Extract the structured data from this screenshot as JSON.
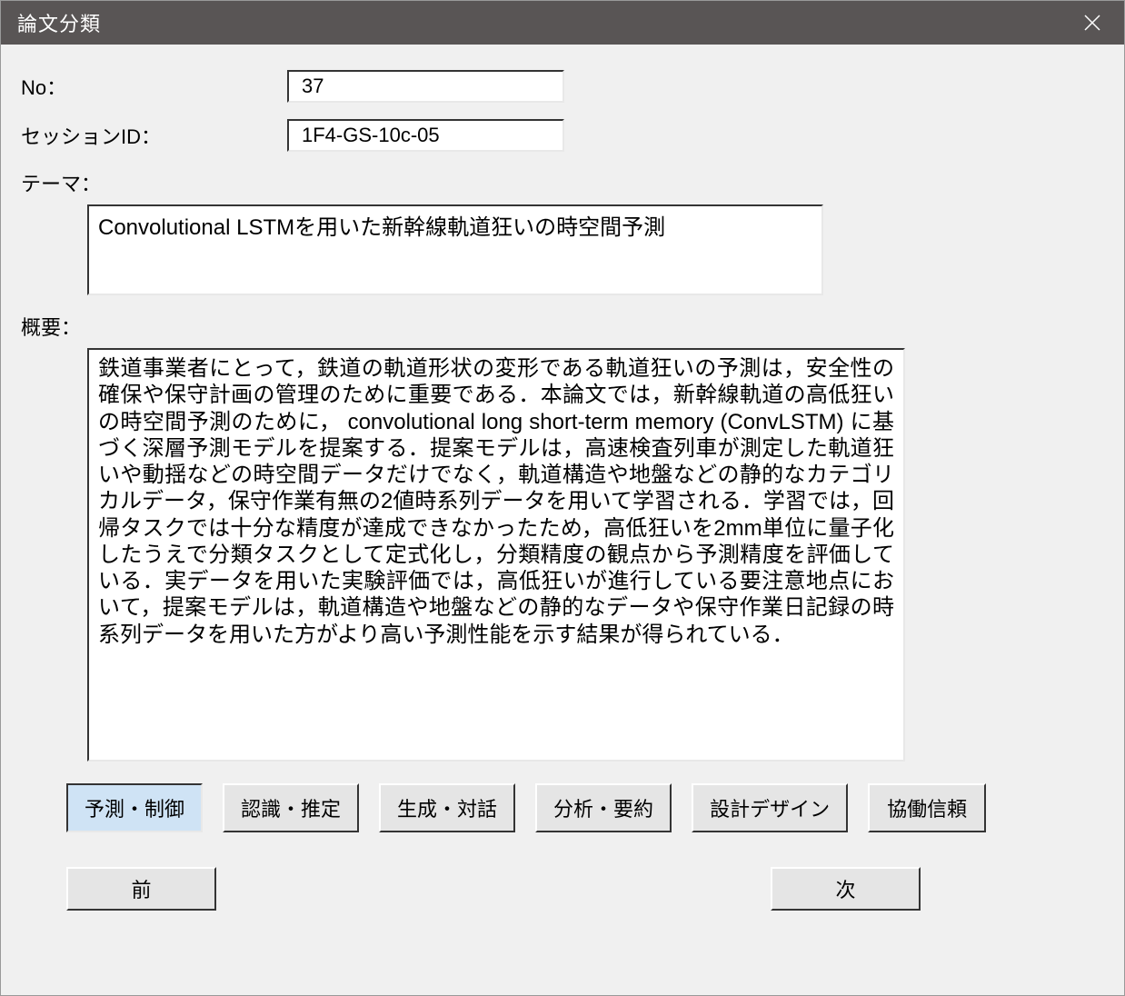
{
  "window": {
    "title": "論文分類"
  },
  "fields": {
    "no_label": "No：",
    "no_value": "37",
    "session_label": "セッションID：",
    "session_value": "1F4-GS-10c-05",
    "theme_label": "テーマ：",
    "theme_value": "Convolutional LSTMを用いた新幹線軌道狂いの時空間予測",
    "summary_label": "概要：",
    "summary_value": "鉄道事業者にとって，鉄道の軌道形状の変形である軌道狂いの予測は，安全性の確保や保守計画の管理のために重要である．本論文では，新幹線軌道の高低狂いの時空間予測のために， convolutional long short-term memory (ConvLSTM) に基づく深層予測モデルを提案する．提案モデルは，高速検査列車が測定した軌道狂いや動揺などの時空間データだけでなく，軌道構造や地盤などの静的なカテゴリカルデータ，保守作業有無の2値時系列データを用いて学習される．学習では，回帰タスクでは十分な精度が達成できなかったため，高低狂いを2mm単位に量子化したうえで分類タスクとして定式化し，分類精度の観点から予測精度を評価している．実データを用いた実験評価では，高低狂いが進行している要注意地点において，提案モデルは，軌道構造や地盤などの静的なデータや保守作業日記録の時系列データを用いた方がより高い予測性能を示す結果が得られている．"
  },
  "categories": [
    {
      "label": "予測・制御",
      "selected": true
    },
    {
      "label": "認識・推定",
      "selected": false
    },
    {
      "label": "生成・対話",
      "selected": false
    },
    {
      "label": "分析・要約",
      "selected": false
    },
    {
      "label": "設計デザイン",
      "selected": false
    },
    {
      "label": "協働信頼",
      "selected": false
    }
  ],
  "nav": {
    "prev": "前",
    "next": "次"
  }
}
